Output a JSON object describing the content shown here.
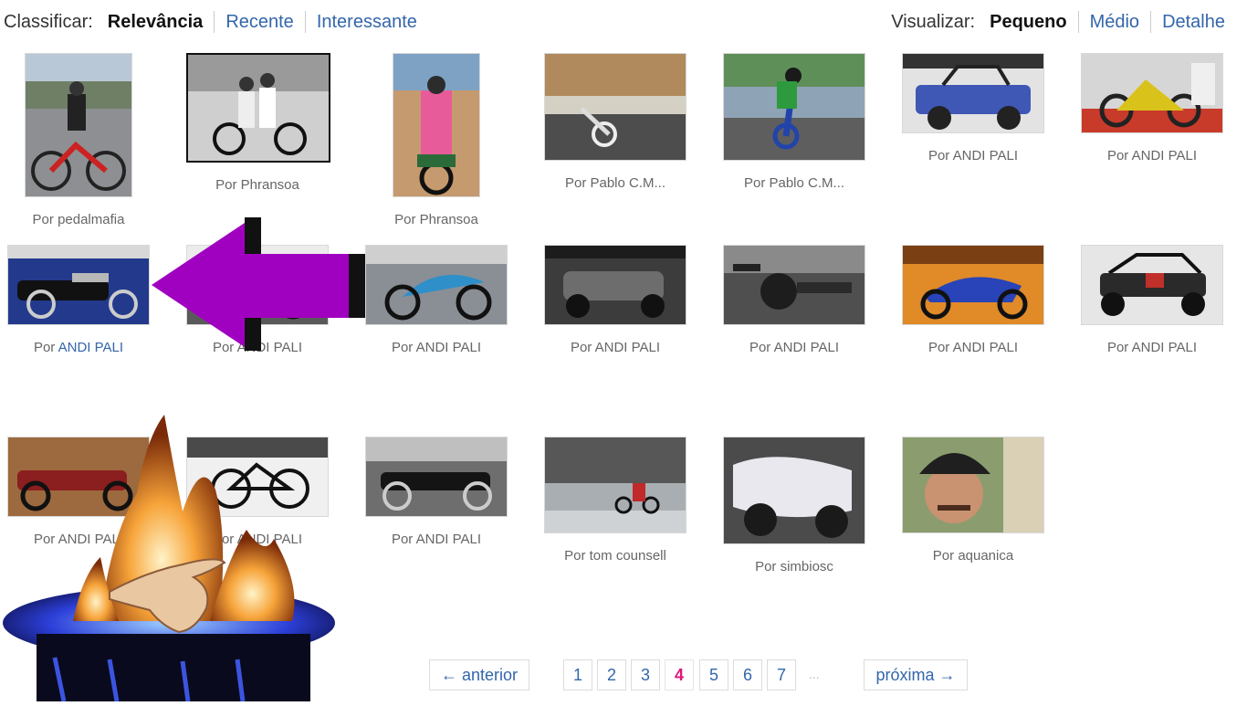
{
  "sort": {
    "label": "Classificar:",
    "options": [
      {
        "label": "Relevância",
        "active": true
      },
      {
        "label": "Recente",
        "active": false
      },
      {
        "label": "Interessante",
        "active": false
      }
    ]
  },
  "view": {
    "label": "Visualizar:",
    "options": [
      {
        "label": "Pequeno",
        "active": true
      },
      {
        "label": "Médio",
        "active": false
      },
      {
        "label": "Detalhe",
        "active": false
      }
    ]
  },
  "tiles": [
    {
      "prefix": "Por",
      "author": "pedalmafia",
      "image": "motocross-rider-photo"
    },
    {
      "prefix": "Por",
      "author": "Phransoa",
      "image": "vintage-family-on-scooter-photo"
    },
    {
      "prefix": "Por",
      "author": "Phransoa",
      "image": "family-on-motorbike-photo"
    },
    {
      "prefix": "Por",
      "author": "Pablo C.M...",
      "image": "stunt-rider-crowd-photo"
    },
    {
      "prefix": "Por",
      "author": "Pablo C.M...",
      "image": "wheelie-stunt-photo"
    },
    {
      "prefix": "Por",
      "author": "ANDI PALI",
      "image": "blue-buggy-photo"
    },
    {
      "prefix": "Por",
      "author": "ANDI PALI",
      "image": "yellow-scooter-photo"
    },
    {
      "prefix": "Por",
      "author": "ANDI PALI",
      "author_link": true,
      "image": "cruiser-motorcycle-photo"
    },
    {
      "prefix": "Por",
      "author": "ANDI PALI",
      "image": "motorcycle-show-photo"
    },
    {
      "prefix": "Por",
      "author": "ANDI PALI",
      "image": "sport-bike-photo"
    },
    {
      "prefix": "Por",
      "author": "ANDI PALI",
      "image": "touring-motorcycle-photo"
    },
    {
      "prefix": "Por",
      "author": "ANDI PALI",
      "image": "motorcycle-handlebar-photo"
    },
    {
      "prefix": "Por",
      "author": "ANDI PALI",
      "image": "blue-sport-bike-photo"
    },
    {
      "prefix": "Por",
      "author": "ANDI PALI",
      "image": "black-buggy-photo"
    },
    {
      "prefix": "Por",
      "author": "ANDI PALI",
      "image": "red-classic-bike-photo"
    },
    {
      "prefix": "Por",
      "author": "ANDI PALI",
      "image": "mountain-bike-photo"
    },
    {
      "prefix": "Por",
      "author": "ANDI PALI",
      "image": "black-cruiser-photo"
    },
    {
      "prefix": "Por",
      "author": "tom counsell",
      "image": "street-riders-photo"
    },
    {
      "prefix": "Por",
      "author": "simbiosc",
      "image": "silver-trike-photo"
    },
    {
      "prefix": "Por",
      "author": "aquanica",
      "image": "helmet-man-portrait-photo"
    }
  ],
  "overlays": {
    "arrow_color": "#a000c0",
    "arrow_icon": "arrow-left-icon",
    "fire_icon": "fire-hand-icon"
  },
  "pager": {
    "prev": "← anterior",
    "next": "próxima →",
    "pages": [
      "1",
      "2",
      "3",
      "4",
      "5",
      "6",
      "7"
    ],
    "current": "4",
    "ellipsis": "..."
  },
  "colors": {
    "link": "#3366aa",
    "current_page": "#e0157a",
    "caption": "#666666"
  }
}
